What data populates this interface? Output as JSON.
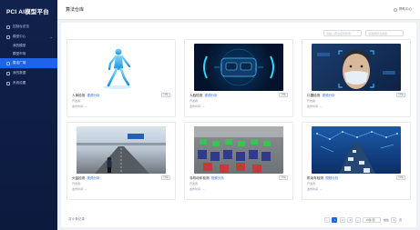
{
  "app": {
    "title": "PCI AI模型平台"
  },
  "sidebar": {
    "items": [
      {
        "label": "控制台总览"
      },
      {
        "label": "模型中心"
      },
      {
        "label": "我的模型"
      },
      {
        "label": "模型市场"
      },
      {
        "label": "算法广场"
      },
      {
        "label": "我的数据"
      },
      {
        "label": "系统设置"
      }
    ]
  },
  "header": {
    "title": "算法仓库",
    "right_label": "帮助中心"
  },
  "filters": {
    "search_placeholder": "请输入算法名称搜索",
    "type_placeholder": "请选择算法类型"
  },
  "cards": [
    {
      "title": "人体检测",
      "tag": "视频分析",
      "btn": "详情",
      "line1": "开发者:",
      "line2": "发布时间: —",
      "scene": "human"
    },
    {
      "title": "人脸检测",
      "tag": "视频分析",
      "btn": "详情",
      "line1": "开发者:",
      "line2": "发布时间: —",
      "scene": "face-car"
    },
    {
      "title": "口罩检测",
      "tag": "视频分析",
      "btn": "详情",
      "line1": "开发者:",
      "line2": "发布时间: —",
      "scene": "mask"
    },
    {
      "title": "头盔检测",
      "tag": "视频分析",
      "btn": "详情",
      "line1": "开发者:",
      "line2": "发布时间: —",
      "scene": "helmet"
    },
    {
      "title": "非机动车检测",
      "tag": "视频分析",
      "btn": "详情",
      "line1": "开发者:",
      "line2": "发布时间: —",
      "scene": "bikes"
    },
    {
      "title": "机动车检测",
      "tag": "视频分析",
      "btn": "详情",
      "line1": "开发者:",
      "line2": "发布时间: —",
      "scene": "traffic"
    }
  ],
  "footer": {
    "total": "共 6 条记录",
    "pages": [
      "1",
      "2",
      "3"
    ],
    "page_size": "10条/页",
    "goto_label": "前往",
    "goto_value": "1",
    "page_unit": "页"
  }
}
